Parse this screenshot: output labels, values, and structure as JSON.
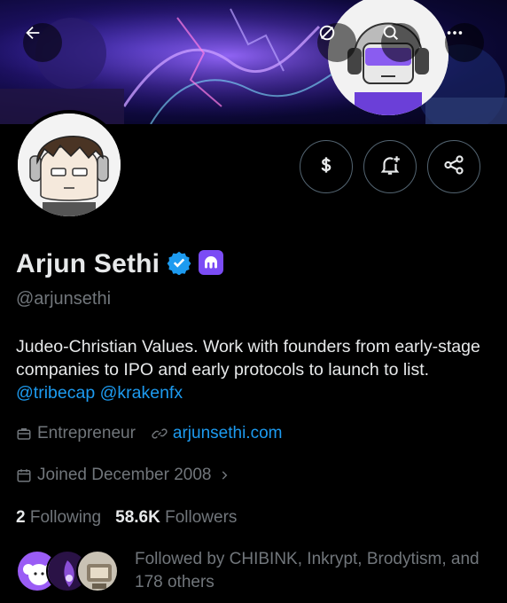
{
  "header": {
    "back_icon": "arrow-left-icon",
    "actions": [
      "no-ads-icon",
      "search-icon",
      "more-icon"
    ]
  },
  "profile": {
    "name": "Arjun Sethi",
    "verified_color": "#1d9bf0",
    "handle": "@arjunsethi",
    "bio_text": "Judeo-Christian Values. Work with founders from early-stage companies to IPO and early protocols to launch to list. ",
    "bio_mention_1": "@tribecap",
    "bio_mention_2": "@krakenfx",
    "category": "Entrepreneur",
    "website": "arjunsethi.com",
    "joined": "Joined December 2008"
  },
  "actions": {
    "tip_icon": "dollar-icon",
    "notify_icon": "bell-plus-icon",
    "share_icon": "share-icon"
  },
  "stats": {
    "following_count": "2",
    "following_label": "Following",
    "followers_count": "58.6K",
    "followers_label": "Followers"
  },
  "followed_by": {
    "text": "Followed by CHIBINK, Inkrypt, Brodytism, and 178 others"
  },
  "colors": {
    "accent": "#1d9bf0",
    "muted": "#71767b",
    "kraken_purple": "#7b4cf5"
  }
}
